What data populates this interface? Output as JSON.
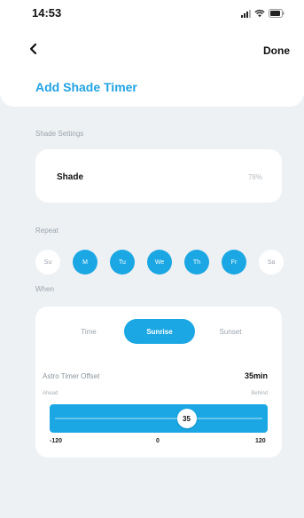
{
  "status_bar": {
    "time": "14:53"
  },
  "nav": {
    "done_label": "Done"
  },
  "title": "Add Shade Timer",
  "shade_settings": {
    "section_label": "Shade Settings",
    "shade_label": "Shade",
    "shade_value": "78%"
  },
  "repeat": {
    "section_label": "Repeat",
    "days": [
      {
        "label": "Su",
        "selected": false
      },
      {
        "label": "M",
        "selected": true
      },
      {
        "label": "Tu",
        "selected": true
      },
      {
        "label": "We",
        "selected": true
      },
      {
        "label": "Th",
        "selected": true
      },
      {
        "label": "Fr",
        "selected": true
      },
      {
        "label": "Sa",
        "selected": false
      }
    ]
  },
  "when": {
    "section_label": "When",
    "segments": [
      "Time",
      "Sunrise",
      "Sunset"
    ],
    "selected_segment": "Sunrise",
    "offset_label": "Astro Timer Offset",
    "offset_value": "35min",
    "ahead_label": "Ahead",
    "behind_label": "Behind",
    "slider": {
      "min": -120,
      "max": 120,
      "value": 35,
      "value_label": "35"
    },
    "tick_labels": [
      "-120",
      "0",
      "120"
    ]
  },
  "colors": {
    "accent": "#1ba7e3",
    "title": "#21a3e3",
    "background": "#eef1f4"
  }
}
